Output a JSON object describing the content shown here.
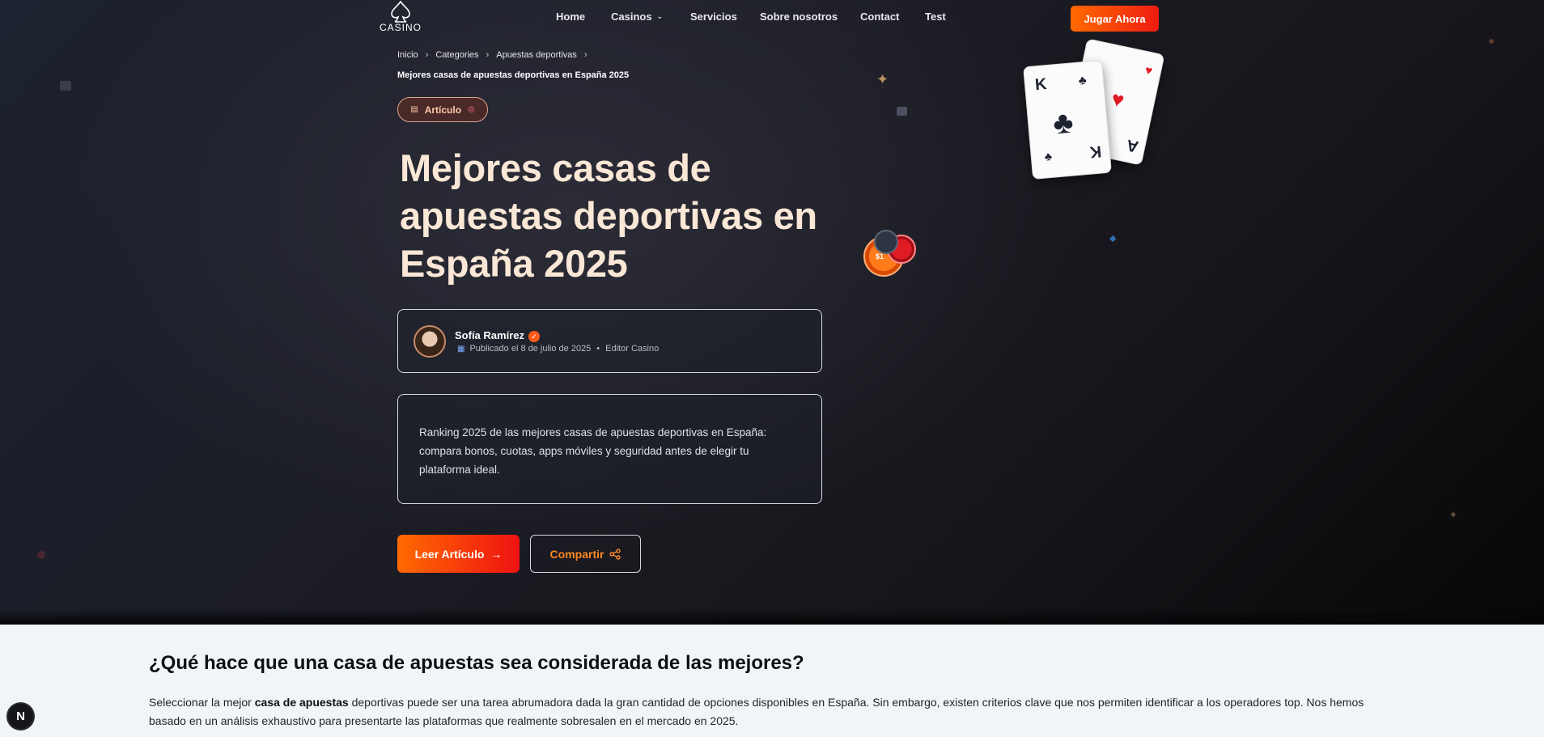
{
  "header": {
    "logo_text": "CASINO",
    "nav": [
      {
        "label": "Home"
      },
      {
        "label": "Casinos"
      },
      {
        "label": "Servicios"
      },
      {
        "label": "Sobre nosotros"
      },
      {
        "label": "Contact"
      },
      {
        "label": "Test"
      }
    ],
    "cta_label": "Jugar Ahora"
  },
  "breadcrumb": {
    "items": [
      "Inicio",
      "Categories",
      "Apuestas deportivas"
    ],
    "current": "Mejores casas de apuestas deportivas en España 2025"
  },
  "badge": {
    "label": "Artículo"
  },
  "article": {
    "title": "Mejores casas de apuestas deportivas en España 2025",
    "author_name": "Sofía Ramírez",
    "published": "Publicado el 8 de julio de 2025",
    "role": "Editor Casino",
    "summary": "Ranking 2025 de las mejores casas de apuestas deportivas en España: compara bonos, cuotas, apps móviles y seguridad antes de elegir tu plataforma ideal.",
    "read_label": "Leer Artículo",
    "share_label": "Compartir"
  },
  "decor": {
    "card_front_rank": "K",
    "card_back_rank": "A",
    "chip_label": "$1"
  },
  "section": {
    "title": "¿Qué hace que una casa de apuestas sea considerada de las mejores?",
    "body_before": "Seleccionar la mejor ",
    "body_bold": "casa de apuestas",
    "body_after": " deportivas puede ser una tarea abrumadora dada la gran cantidad de opciones disponibles en España. Sin embargo, existen criterios clave que nos permiten identificar a los operadores top. Nos hemos basado en un análisis exhaustivo para presentarte las plataformas que realmente sobresalen en el mercado en 2025."
  },
  "dev_badge": "N",
  "colors": {
    "accent_start": "#ff6a00",
    "accent_end": "#ef1c12",
    "title": "#fbe7d6",
    "share_text": "#ff8a1f"
  }
}
